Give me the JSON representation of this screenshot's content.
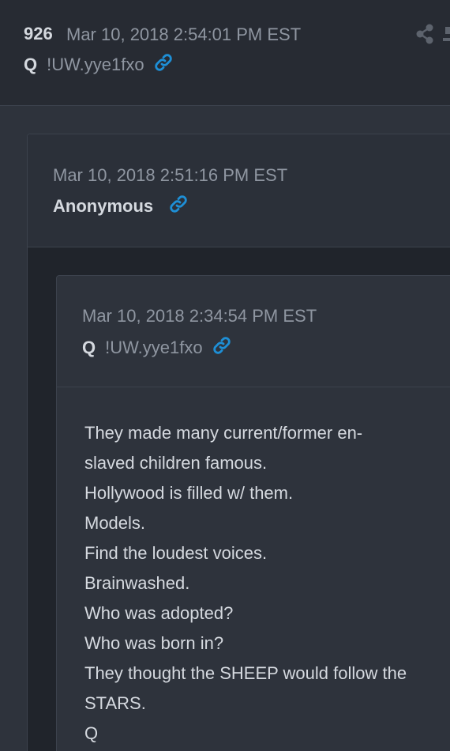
{
  "post": {
    "number": "926",
    "timestamp": "Mar 10, 2018 2:54:01 PM EST",
    "author": "Q",
    "tripcode": "!UW.yye1fxo"
  },
  "quoted_post": {
    "timestamp": "Mar 10, 2018 2:51:16 PM EST",
    "author": "Anonymous"
  },
  "nested_quote": {
    "timestamp": "Mar 10, 2018 2:34:54 PM EST",
    "author": "Q",
    "tripcode": "!UW.yye1fxo",
    "lines": [
      "They made many current/former en-",
      "slaved children famous.",
      "Hollywood is filled w/ them.",
      "Models.",
      "Find the loudest voices.",
      "Brainwashed.",
      "Who was adopted?",
      "Who was born in?",
      "They thought the SHEEP would follow the",
      "STARS.",
      "Q"
    ]
  },
  "icons": {
    "link": "link-icon",
    "share": "share-icon"
  },
  "colors": {
    "link": "#1e8fd6",
    "text": "#d5d9df",
    "muted": "#8f96a1"
  }
}
